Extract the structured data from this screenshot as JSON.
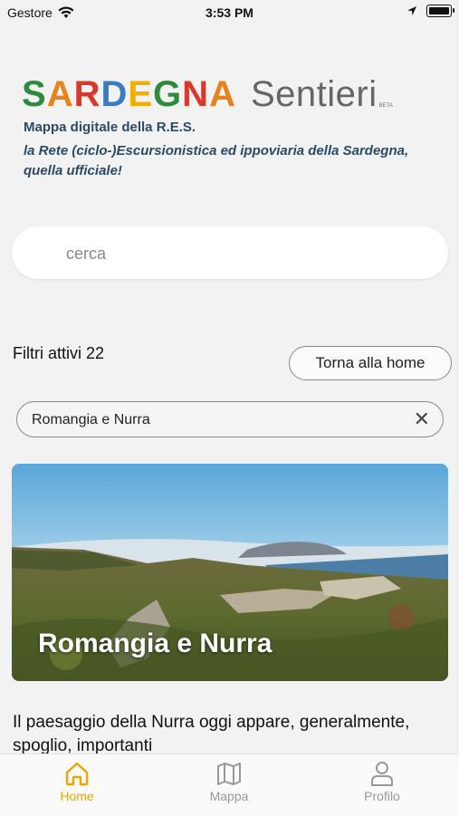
{
  "status_bar": {
    "carrier": "Gestore",
    "time": "3:53 PM"
  },
  "logo": {
    "main_letters": [
      {
        "ch": "S",
        "color": "#2e8b3d"
      },
      {
        "ch": "A",
        "color": "#e8821d"
      },
      {
        "ch": "R",
        "color": "#d63a2c"
      },
      {
        "ch": "D",
        "color": "#3a7cc3"
      },
      {
        "ch": "E",
        "color": "#f0b000"
      },
      {
        "ch": "G",
        "color": "#2e8b3d"
      },
      {
        "ch": "N",
        "color": "#d63a2c"
      },
      {
        "ch": "A",
        "color": "#e8821d"
      }
    ],
    "sub": "Sentieri",
    "beta": "BETA"
  },
  "tagline": {
    "line1": "Mappa digitale della R.E.S.",
    "line2": "la Rete (ciclo-)Escursionistica ed ippoviaria della Sardegna, quella ufficiale!"
  },
  "search": {
    "placeholder": "cerca"
  },
  "filters": {
    "label": "Filtri attivi 22",
    "home_button": "Torna alla home"
  },
  "chip": {
    "label": "Romangia e Nurra",
    "close": "✕"
  },
  "card": {
    "title": "Romangia e Nurra"
  },
  "description": "Il paesaggio della Nurra oggi appare, generalmente, spoglio, importanti",
  "tabbar": {
    "tabs": [
      {
        "label": "Home",
        "icon": "home-icon",
        "active": true
      },
      {
        "label": "Mappa",
        "icon": "map-icon",
        "active": false
      },
      {
        "label": "Profilo",
        "icon": "user-icon",
        "active": false
      }
    ],
    "active_color": "#f0a500",
    "inactive_color": "#999999"
  }
}
